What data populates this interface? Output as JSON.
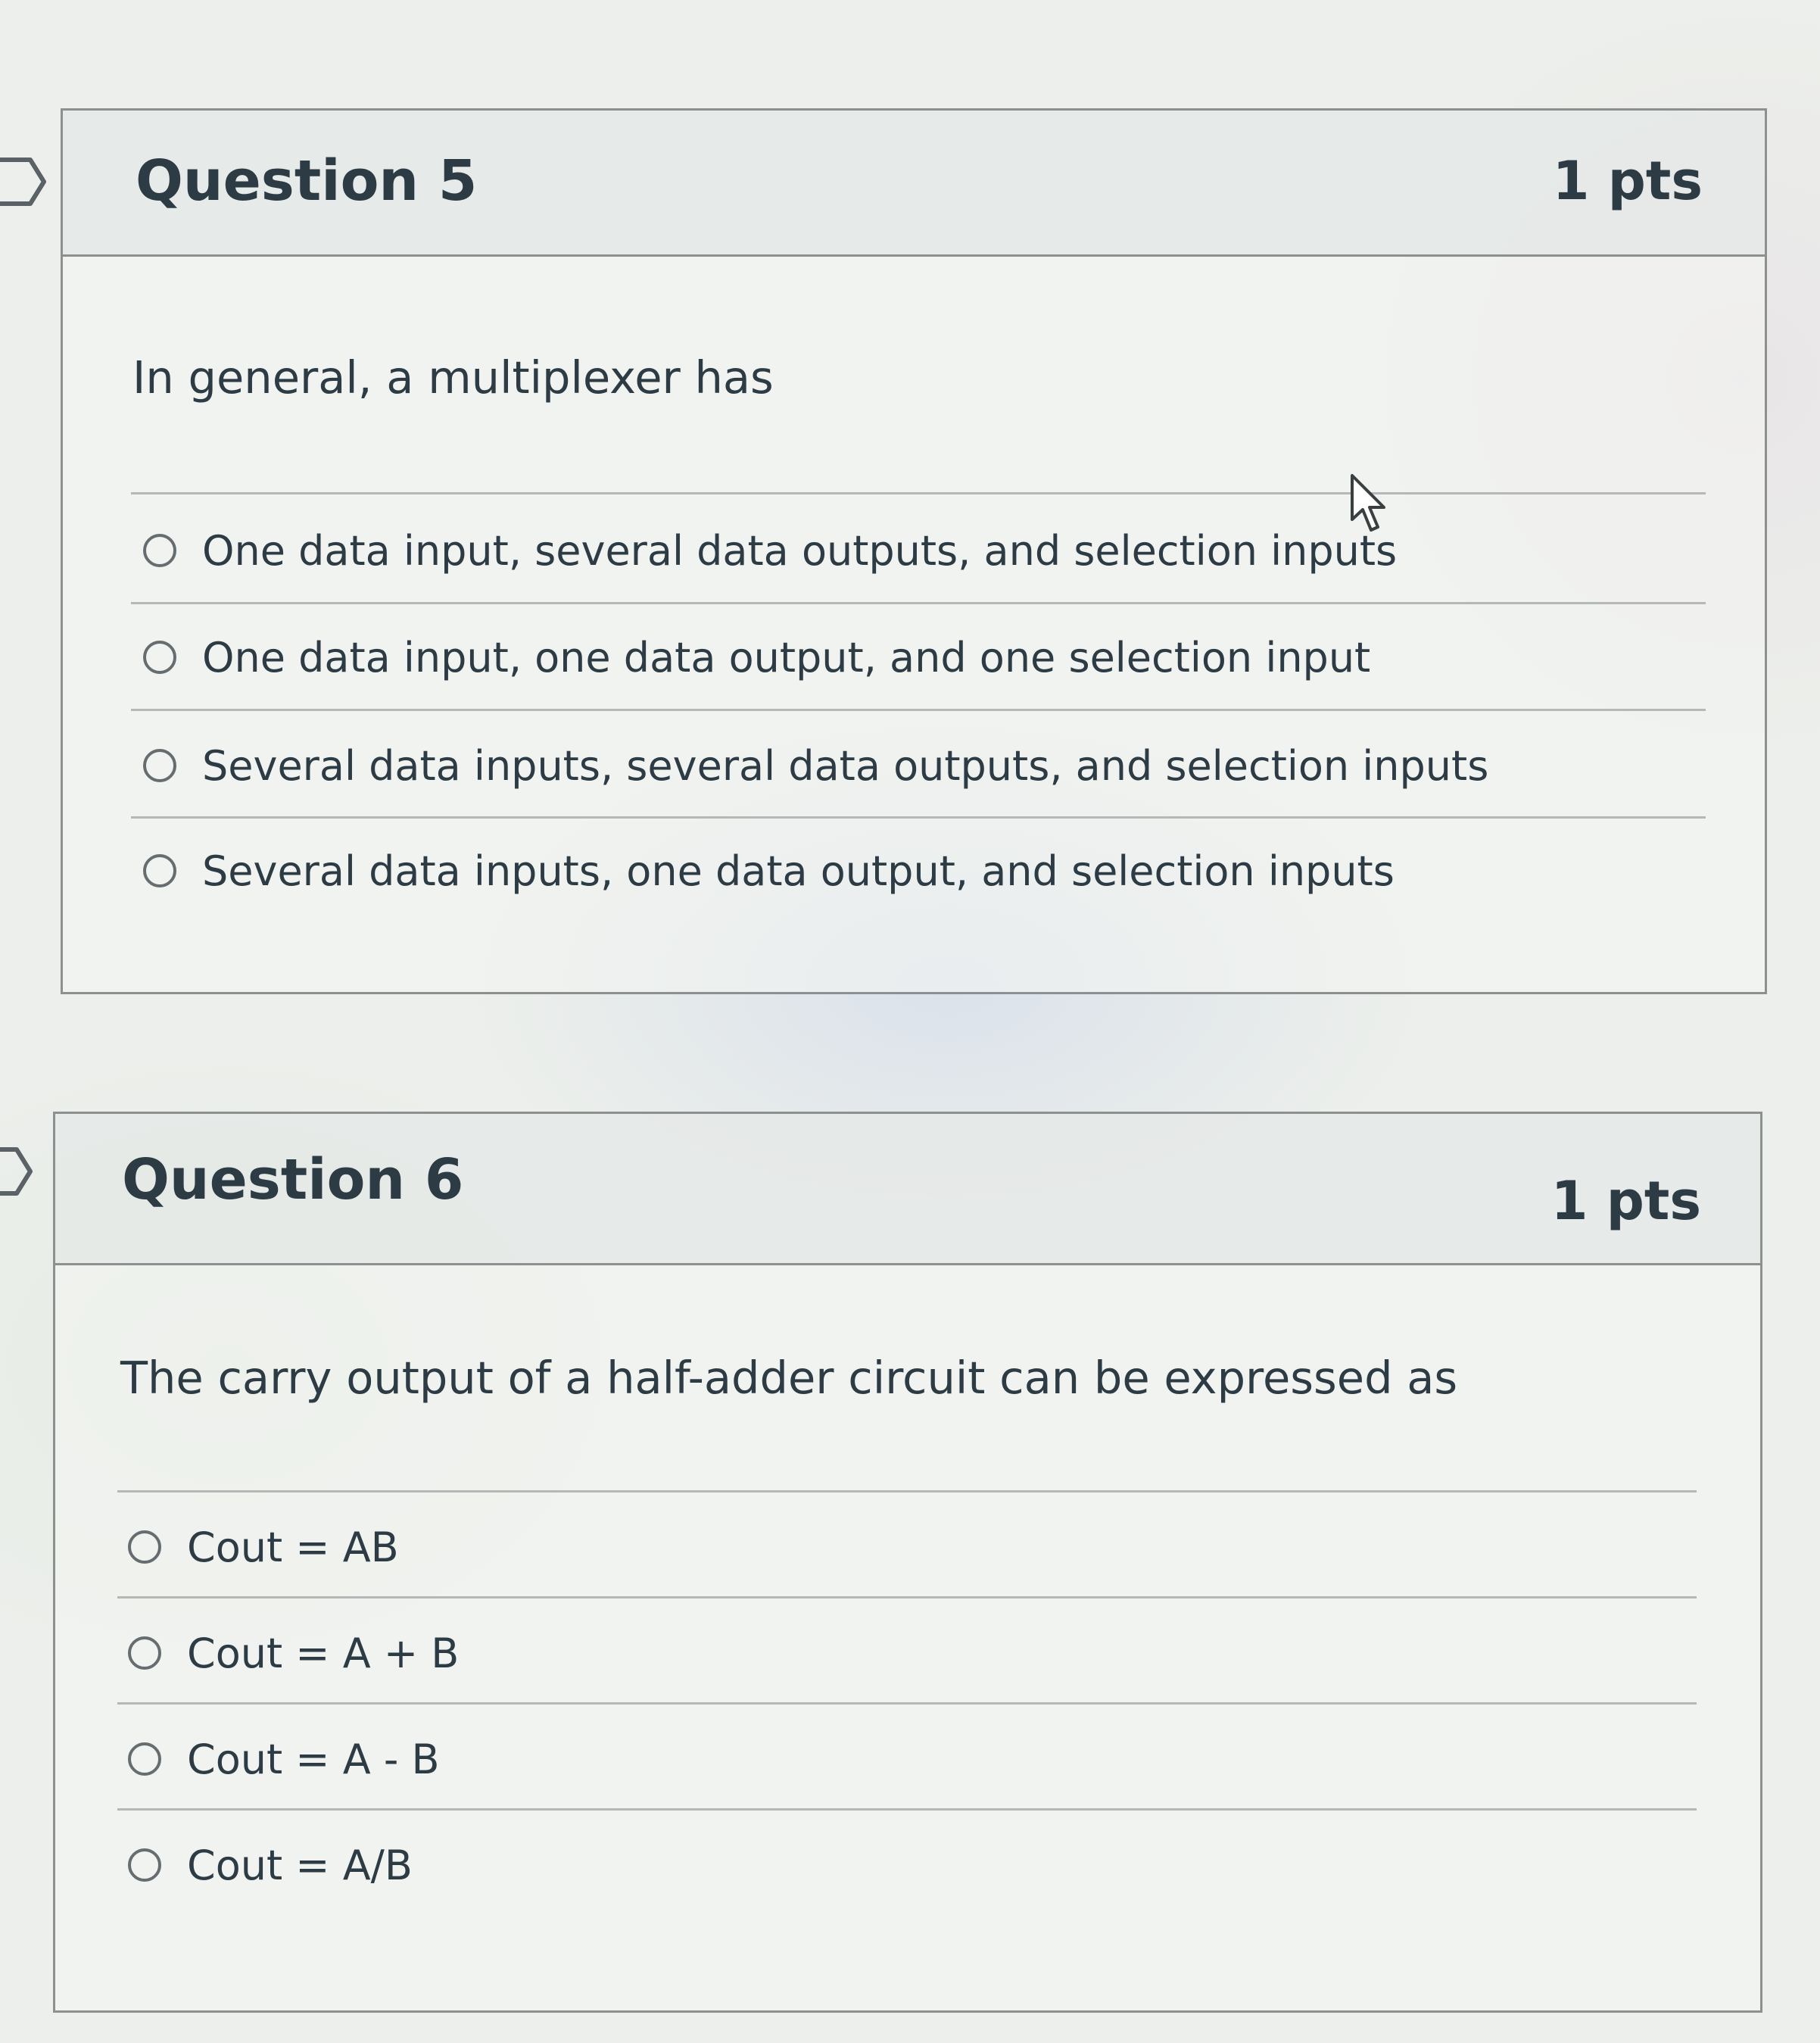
{
  "questions": [
    {
      "title": "Question 5",
      "points": "1 pts",
      "text": "In general, a multiplexer has",
      "answers": [
        "One data input, several data outputs, and selection inputs",
        "One data input, one data output, and one selection input",
        "Several data inputs, several data outputs, and selection inputs",
        "Several data inputs, one data output, and selection inputs"
      ]
    },
    {
      "title": "Question 6",
      "points": "1 pts",
      "text": "The carry output of a half-adder circuit can be expressed as",
      "answers": [
        "Cout = AB",
        "Cout = A + B",
        "Cout = A - B",
        "Cout = A/B"
      ]
    }
  ],
  "icons": {
    "nav": "chevron-right-icon",
    "pointer": "mouse-pointer-icon"
  },
  "colors": {
    "text": "#2d3b45",
    "border": "#8c9190",
    "header_bg": "#e2e6e5"
  }
}
